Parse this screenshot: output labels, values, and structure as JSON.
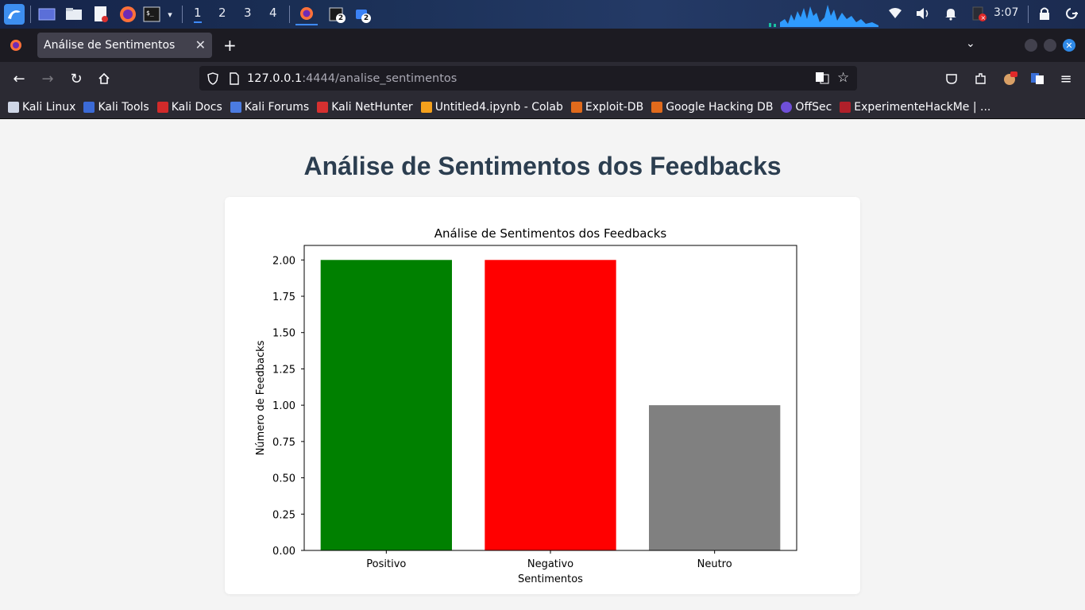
{
  "taskbar": {
    "workspaces": [
      "1",
      "2",
      "3",
      "4"
    ],
    "badges": [
      "2",
      "2"
    ],
    "clock": "3:07"
  },
  "browser": {
    "tab_title": "Análise de Sentimentos",
    "url_host": "127.0.0.1",
    "url_path": ":4444/analise_sentimentos",
    "bookmarks": [
      {
        "label": "Kali Linux",
        "color": "#cfd6e6"
      },
      {
        "label": "Kali Tools",
        "color": "#3b6ad6"
      },
      {
        "label": "Kali Docs",
        "color": "#d12a2a"
      },
      {
        "label": "Kali Forums",
        "color": "#4b7be0"
      },
      {
        "label": "Kali NetHunter",
        "color": "#d63030"
      },
      {
        "label": "Untitled4.ipynb - Colab",
        "color": "#f4a01c"
      },
      {
        "label": "Exploit-DB",
        "color": "#e06a1c"
      },
      {
        "label": "Google Hacking DB",
        "color": "#e06a1c"
      },
      {
        "label": "OffSec",
        "color": "#6f4fd8"
      },
      {
        "label": "ExperimenteHackMe | ...",
        "color": "#b0202a"
      }
    ]
  },
  "page": {
    "heading": "Análise de Sentimentos dos Feedbacks"
  },
  "chart_data": {
    "type": "bar",
    "title": "Análise de Sentimentos dos Feedbacks",
    "xlabel": "Sentimentos",
    "ylabel": "Número de Feedbacks",
    "categories": [
      "Positivo",
      "Negativo",
      "Neutro"
    ],
    "values": [
      2,
      2,
      1
    ],
    "colors": [
      "#008000",
      "#ff0000",
      "#808080"
    ],
    "ylim": [
      0,
      2.1
    ],
    "yticks": [
      "0.00",
      "0.25",
      "0.50",
      "0.75",
      "1.00",
      "1.25",
      "1.50",
      "1.75",
      "2.00"
    ],
    "ytick_values": [
      0,
      0.25,
      0.5,
      0.75,
      1.0,
      1.25,
      1.5,
      1.75,
      2.0
    ],
    "grid": false
  }
}
